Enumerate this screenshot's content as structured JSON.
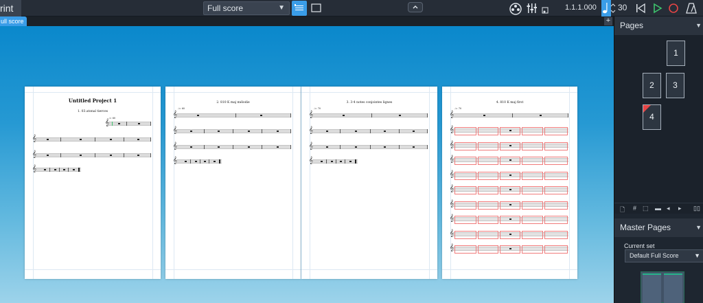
{
  "toolbar": {
    "mode_label": "rint",
    "layout_select": "Full score",
    "position": "1.1.1.000",
    "tempo": "30",
    "icons": [
      "galley-view-icon",
      "page-view-icon",
      "collapse-icon",
      "video-icon",
      "mixer-icon",
      "sound-icon",
      "note-tempo-icon",
      "rewind-icon",
      "play-icon",
      "record-icon",
      "metronome-icon"
    ],
    "colors": {
      "accent": "#3a9de8",
      "play": "#3ec46d",
      "record": "#e64545"
    }
  },
  "tabs": [
    {
      "label": "ull score"
    }
  ],
  "tab_add_label": "+",
  "score": {
    "project_title": "Untitled Project 1",
    "flows": [
      {
        "title": "1. 03.atonal tierces",
        "tempo": "♩= 60"
      },
      {
        "title": "2. 810 K maj mélodie",
        "tempo": "♩= 60"
      },
      {
        "title": "3. 3-4 notes conjointes lignes",
        "tempo": "♩= 70"
      },
      {
        "title": "4. 810 K maj  first",
        "tempo": "♩= 70"
      }
    ]
  },
  "pages_panel": {
    "title": "Pages",
    "pages": [
      "1",
      "2",
      "3",
      "4"
    ],
    "tools": [
      "new-page-icon",
      "#",
      "frame-icon",
      "break-icon",
      "◂",
      "▸"
    ]
  },
  "master_pages_panel": {
    "title": "Master Pages",
    "current_set_label": "Current set",
    "current_set_value": "Default Full Score"
  }
}
